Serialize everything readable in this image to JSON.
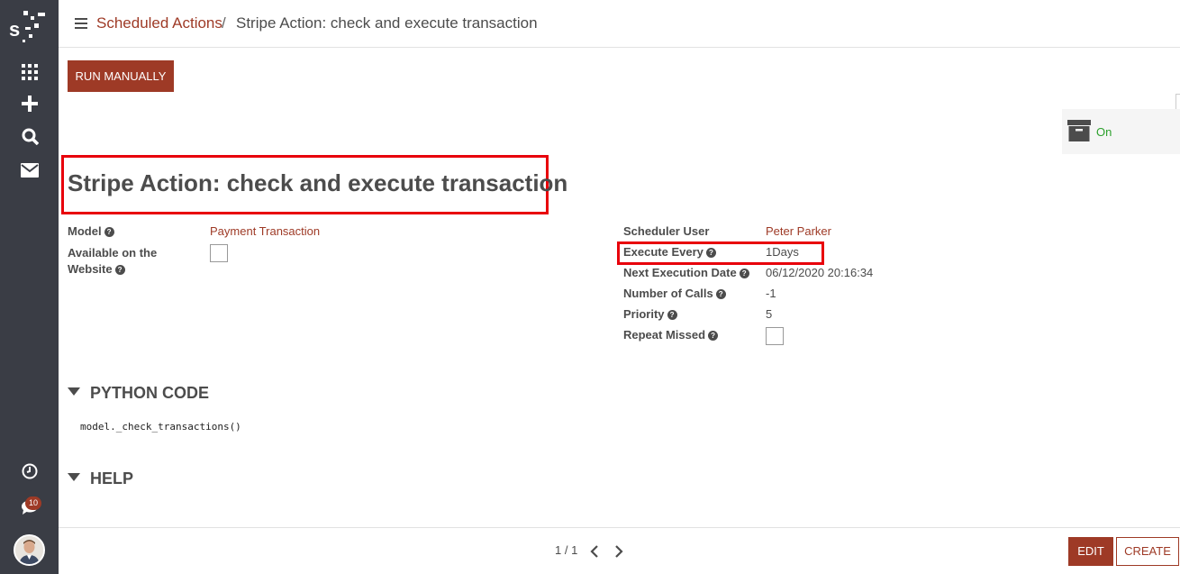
{
  "breadcrumb": {
    "parent": "Scheduled Actions",
    "separator": "/",
    "current": "Stripe Action: check and execute transaction"
  },
  "toolbar": {
    "run_label": "RUN MANUALLY"
  },
  "status": {
    "label": "On",
    "color": "#2ca02c"
  },
  "record": {
    "title": "Stripe Action: check and execute transaction",
    "left_fields": {
      "model_label": "Model",
      "model_value": "Payment Transaction",
      "website_label_line1": "Available on the",
      "website_label_line2": "Website",
      "website_checked": false
    },
    "right_fields": {
      "user_label": "Scheduler User",
      "user_value": "Peter Parker",
      "every_label": "Execute Every",
      "every_value": "1Days",
      "next_label": "Next Execution Date",
      "next_value": "06/12/2020 20:16:34",
      "calls_label": "Number of Calls",
      "calls_value": "-1",
      "priority_label": "Priority",
      "priority_value": "5",
      "repeat_label": "Repeat Missed",
      "repeat_checked": false
    }
  },
  "sections": {
    "python_title": "PYTHON CODE",
    "python_code": "model._check_transactions()",
    "help_title": "HELP"
  },
  "sidebar": {
    "notification_count": "10",
    "logo_letter": "s"
  },
  "pager": {
    "text": "1 / 1"
  },
  "bottom": {
    "edit_label": "EDIT",
    "create_label": "CREATE"
  },
  "colors": {
    "accent": "#9e3a26",
    "sidebar": "#3a3d45",
    "highlight": "#e8000b"
  },
  "icons": [
    "apps-icon",
    "plus-icon",
    "search-icon",
    "mail-icon",
    "clock-icon",
    "chat-icon",
    "archive-icon",
    "chevron-left-icon",
    "chevron-right-icon",
    "help-icon",
    "menu-icon"
  ]
}
